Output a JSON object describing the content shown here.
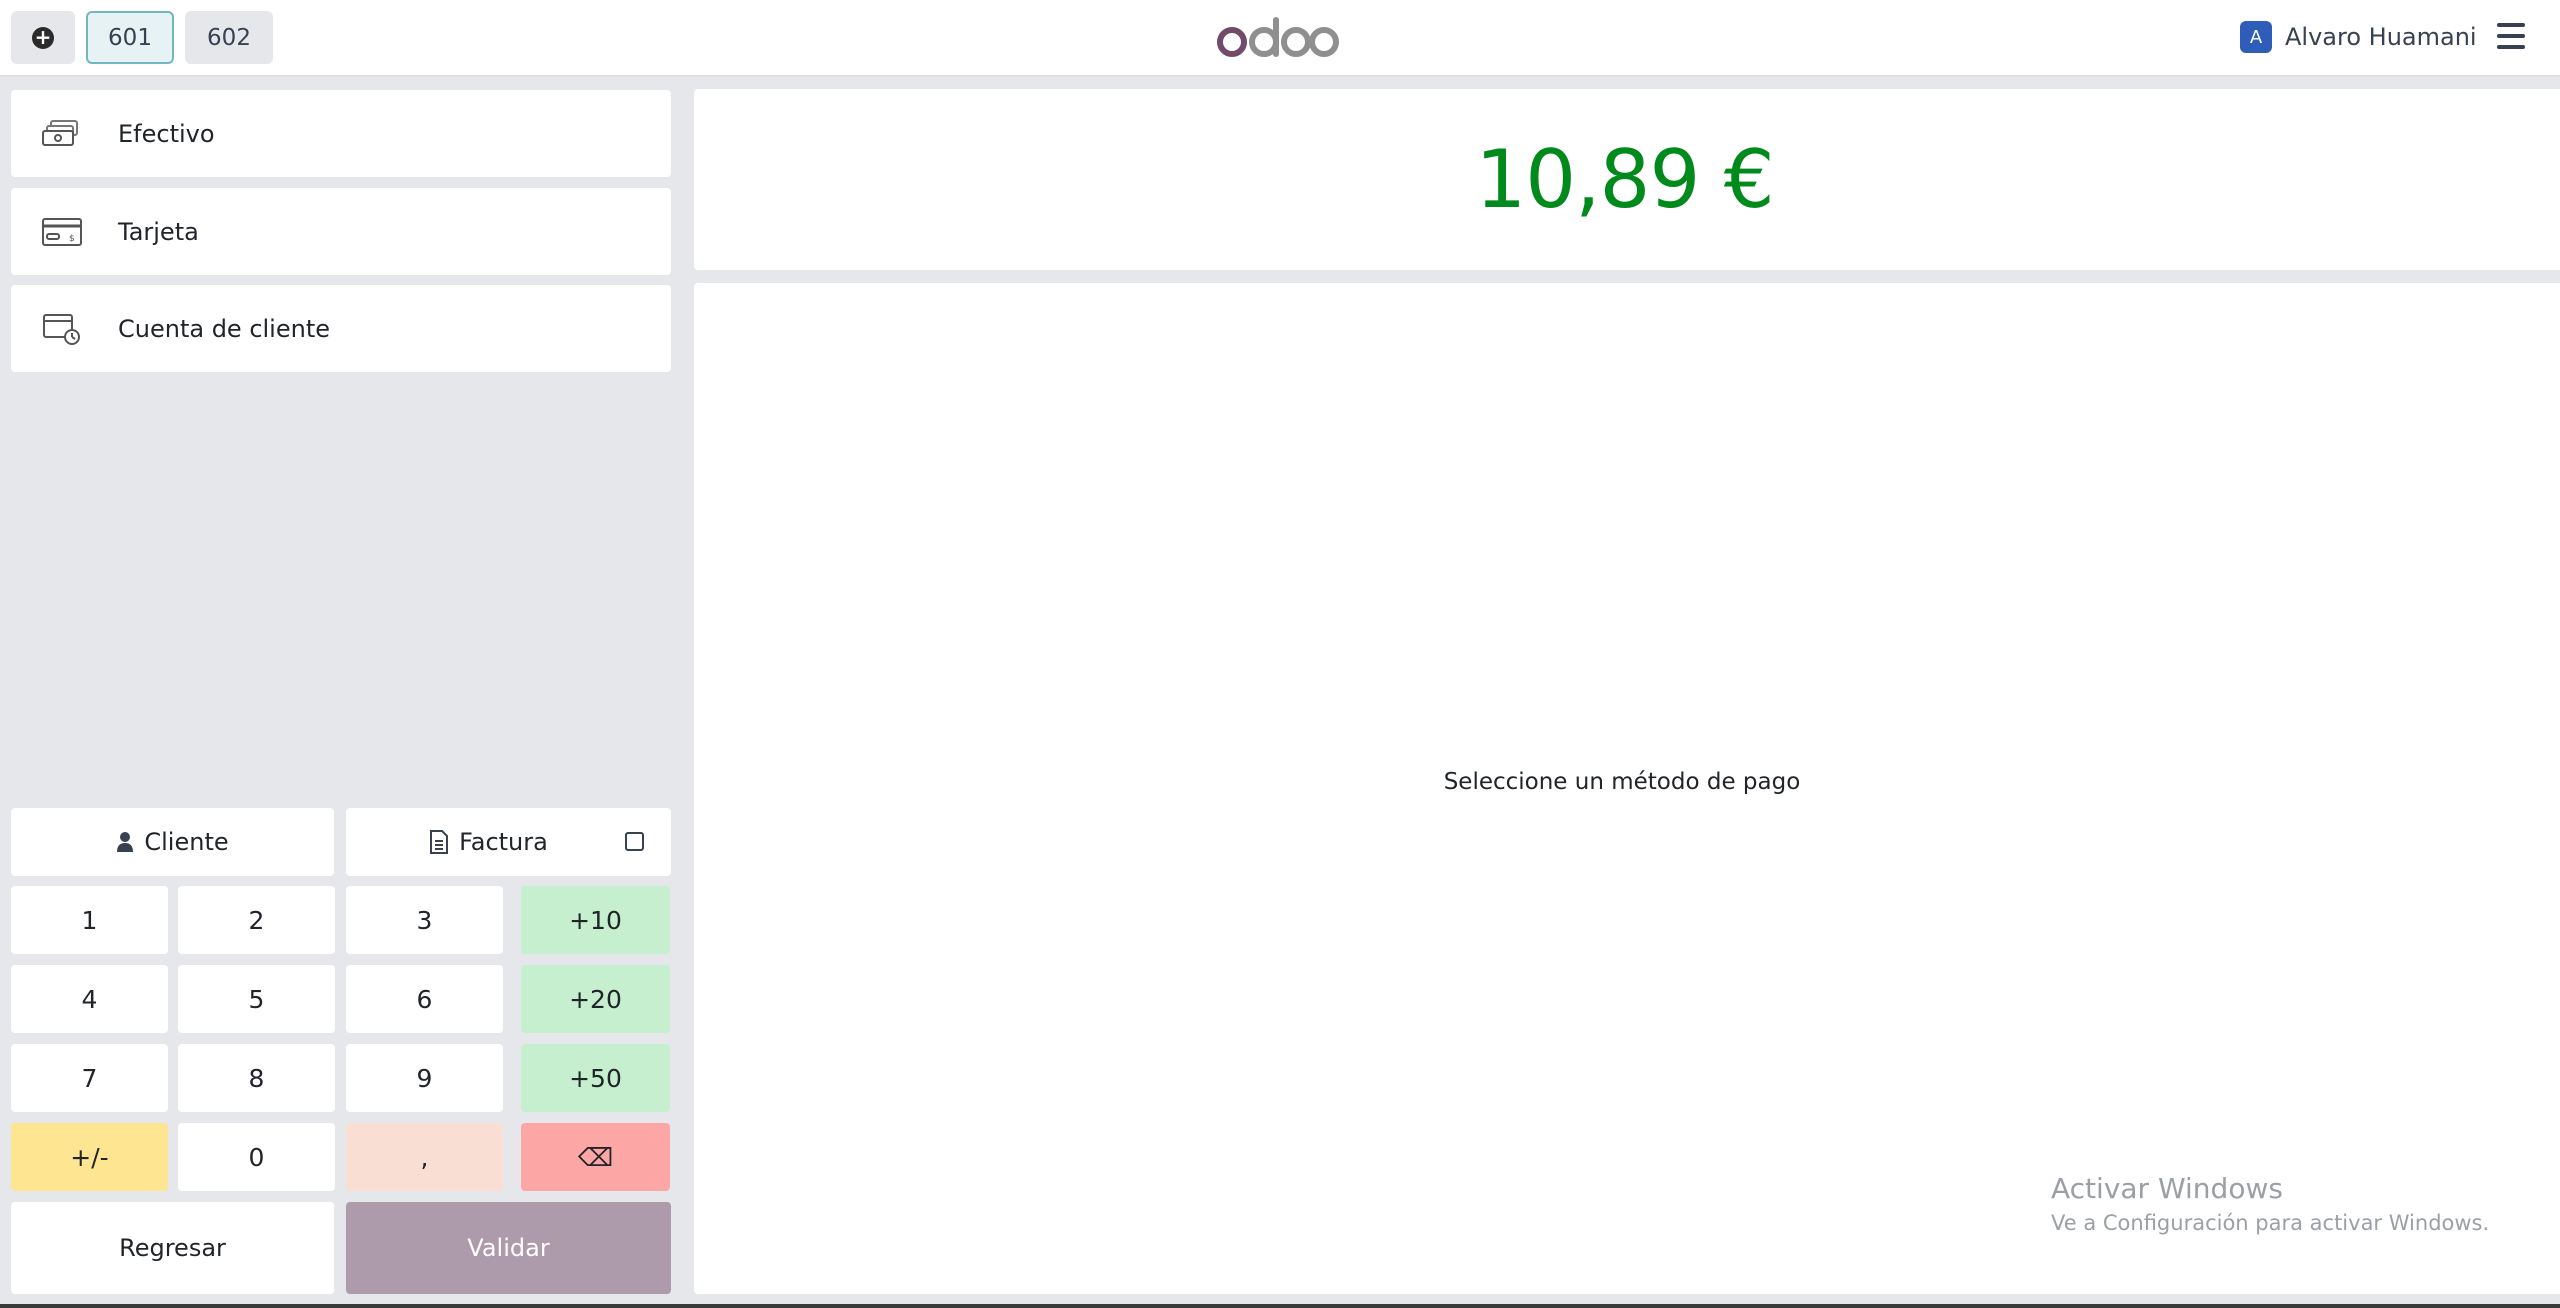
{
  "header": {
    "add_order_icon": "plus-circle-icon",
    "order_tabs": [
      {
        "label": "601",
        "active": true
      },
      {
        "label": "602",
        "active": false
      }
    ],
    "logo_text": "odoo",
    "user_initial": "A",
    "user_name": "Alvaro Huamani",
    "menu_icon": "hamburger-icon"
  },
  "payment_methods": [
    {
      "label": "Efectivo",
      "icon": "cash-icon"
    },
    {
      "label": "Tarjeta",
      "icon": "card-icon"
    },
    {
      "label": "Cuenta de cliente",
      "icon": "customer-account-icon"
    }
  ],
  "actions": {
    "customer_label": "Cliente",
    "invoice_label": "Factura",
    "invoice_checked": false
  },
  "keypad": {
    "k1": "1",
    "k2": "2",
    "k3": "3",
    "plus10": "+10",
    "k4": "4",
    "k5": "5",
    "k6": "6",
    "plus20": "+20",
    "k7": "7",
    "k8": "8",
    "k9": "9",
    "plus50": "+50",
    "plusminus": "+/-",
    "k0": "0",
    "comma": ",",
    "backspace": "⌫"
  },
  "footer_buttons": {
    "back_label": "Regresar",
    "validate_label": "Validar"
  },
  "summary": {
    "total": "10,89 €",
    "hint": "Seleccione un método de pago"
  },
  "watermark": {
    "line1": "Activar Windows",
    "line2": "Ve a Configuración para activar Windows."
  },
  "colors": {
    "total_green": "#018a1c",
    "validate_bg": "#ad9bab",
    "quick_add_green": "#c6efcf",
    "sign_yellow": "#fde592",
    "backspace_red": "#fda6a6",
    "logo_purple": "#714b67"
  }
}
